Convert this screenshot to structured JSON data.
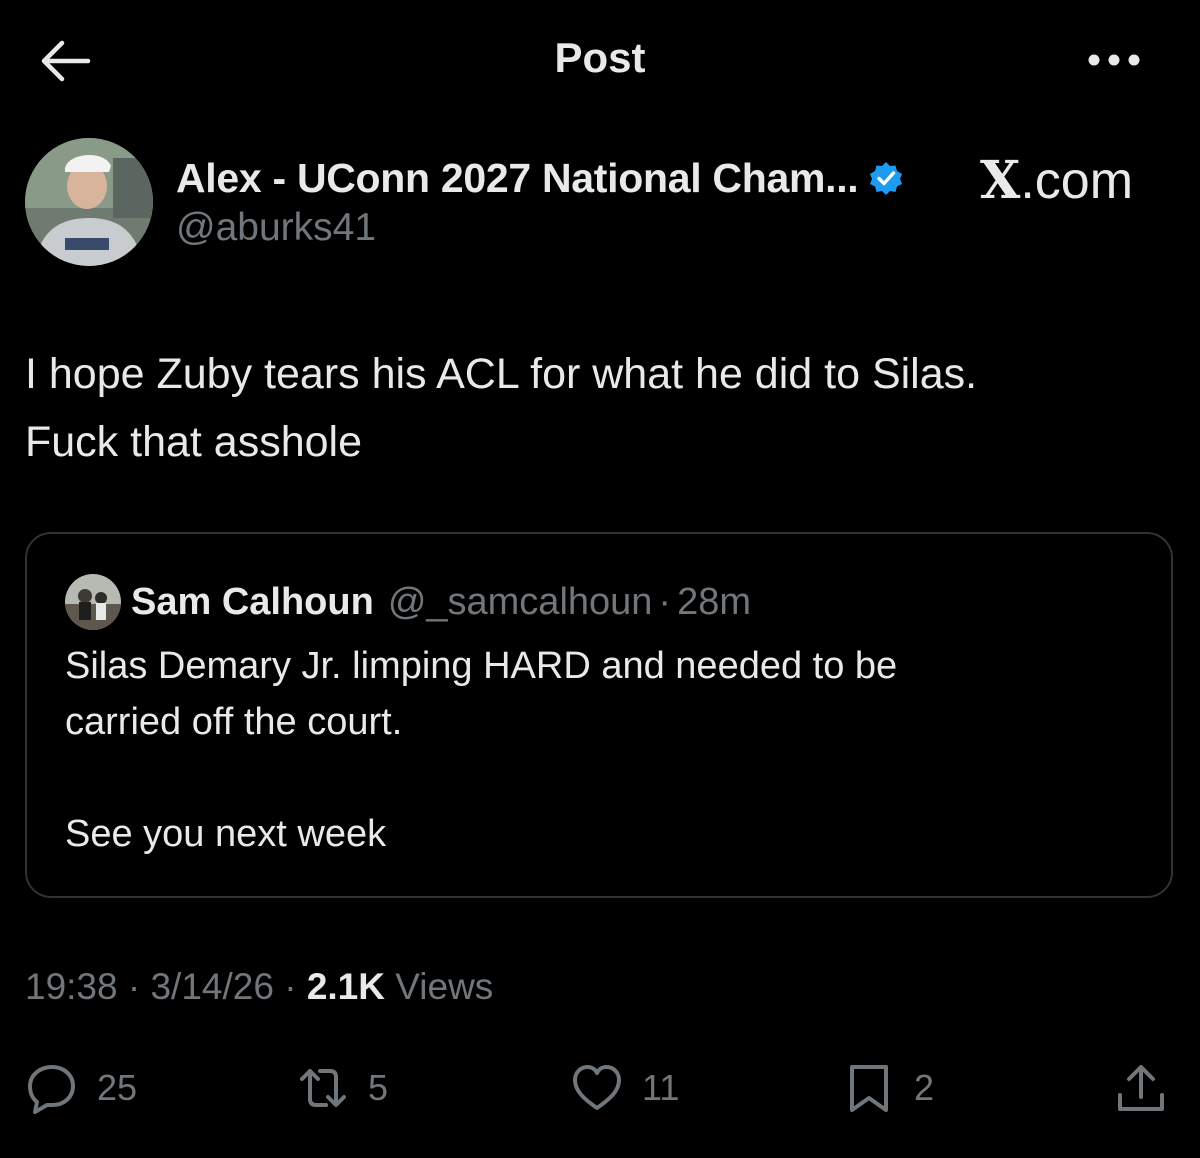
{
  "header": {
    "title": "Post"
  },
  "author": {
    "name": "Alex - UConn 2027 National Cham...",
    "handle": "@aburks41",
    "brand": "X.com"
  },
  "post": {
    "text": "I hope Zuby tears his ACL for what he did to Silas.\nFuck that asshole",
    "time": "19:38",
    "date": "3/14/26",
    "views_count": "2.1K",
    "views_label": "Views"
  },
  "quote": {
    "name": "Sam Calhoun",
    "handle": "@_samcalhoun",
    "time": "28m",
    "text": "Silas Demary Jr. limping HARD and needed to be\ncarried off the court.\n\nSee you next week"
  },
  "actions": {
    "replies": "25",
    "reposts": "5",
    "likes": "11",
    "bookmarks": "2"
  },
  "colors": {
    "background": "#000000",
    "text": "#e7e9ea",
    "muted": "#71767b",
    "verified": "#1d9bf0",
    "border": "#2f3336"
  },
  "icons": [
    "back-arrow-icon",
    "more-icon",
    "verified-badge-icon",
    "reply-icon",
    "repost-icon",
    "like-icon",
    "bookmark-icon",
    "share-icon"
  ]
}
